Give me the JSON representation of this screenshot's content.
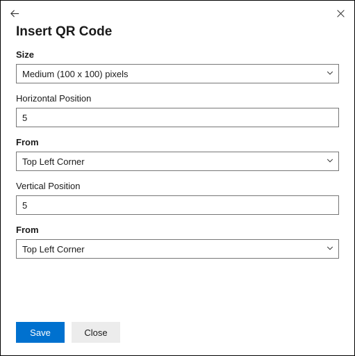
{
  "title": "Insert QR Code",
  "fields": {
    "size": {
      "label": "Size",
      "value": "Medium (100 x 100) pixels"
    },
    "hpos": {
      "label": "Horizontal Position",
      "value": "5"
    },
    "hfrom": {
      "label": "From",
      "value": "Top Left Corner"
    },
    "vpos": {
      "label": "Vertical Position",
      "value": "5"
    },
    "vfrom": {
      "label": "From",
      "value": "Top Left Corner"
    }
  },
  "buttons": {
    "save": "Save",
    "close": "Close"
  }
}
